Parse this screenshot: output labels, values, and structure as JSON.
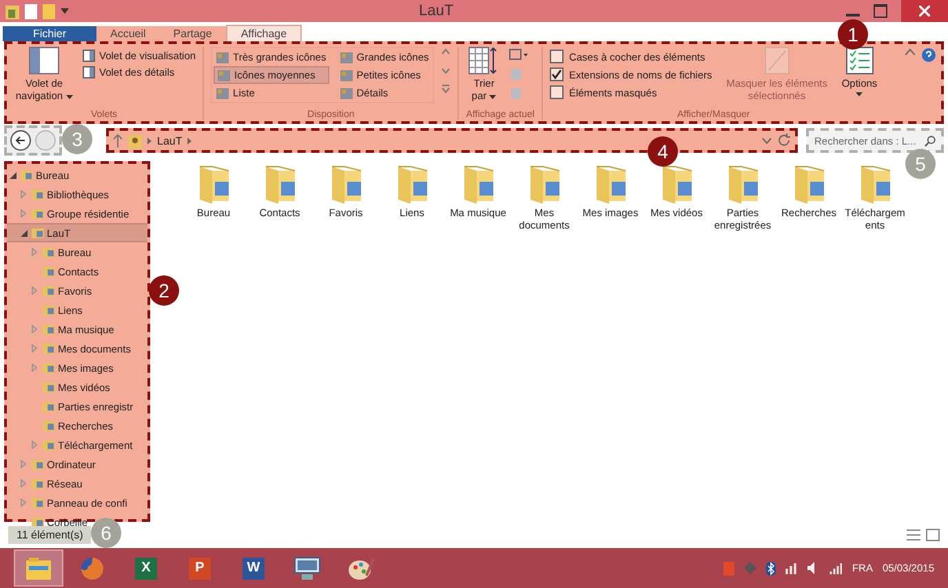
{
  "window": {
    "title": "LauT"
  },
  "ribbon_tabs": [
    {
      "label": "Fichier",
      "kind": "file",
      "selected": false
    },
    {
      "label": "Accueil",
      "kind": "tab",
      "selected": false
    },
    {
      "label": "Partage",
      "kind": "tab",
      "selected": false
    },
    {
      "label": "Affichage",
      "kind": "tab",
      "selected": true
    }
  ],
  "ribbon": {
    "panes": {
      "big_button": "Volet de navigation",
      "items": [
        "Volet de visualisation",
        "Volet des détails"
      ],
      "group_label": "Volets"
    },
    "layout": {
      "options": [
        {
          "label": "Très grandes icônes",
          "selected": false
        },
        {
          "label": "Grandes icônes",
          "selected": false
        },
        {
          "label": "Icônes moyennes",
          "selected": true
        },
        {
          "label": "Petites icônes",
          "selected": false
        },
        {
          "label": "Liste",
          "selected": false
        },
        {
          "label": "Détails",
          "selected": false
        }
      ],
      "group_label": "Disposition"
    },
    "current_view": {
      "sort_button": "Trier par",
      "group_label": "Affichage actuel"
    },
    "show_hide": {
      "checkboxes": [
        {
          "label": "Cases à cocher des éléments",
          "checked": false
        },
        {
          "label": "Extensions de noms de fichiers",
          "checked": true
        },
        {
          "label": "Éléments masqués",
          "checked": false
        }
      ],
      "hide_button": {
        "label": "Masquer les éléments sélectionnés",
        "disabled": true
      },
      "options_button": "Options",
      "group_label": "Afficher/Masquer"
    }
  },
  "address_bar": {
    "path": [
      "LauT"
    ]
  },
  "search": {
    "placeholder": "Rechercher dans : L..."
  },
  "nav_tree": [
    {
      "label": "Bureau",
      "expandable": true,
      "expanded": true,
      "selected": false,
      "children": [
        {
          "label": "Bibliothèques",
          "expandable": true,
          "expanded": false,
          "selected": false
        },
        {
          "label": "Groupe résidentie",
          "expandable": true,
          "expanded": false,
          "selected": false
        },
        {
          "label": "LauT",
          "expandable": true,
          "expanded": true,
          "selected": true,
          "children": [
            {
              "label": "Bureau",
              "expandable": true,
              "expanded": false,
              "selected": false
            },
            {
              "label": "Contacts",
              "expandable": false,
              "selected": false
            },
            {
              "label": "Favoris",
              "expandable": true,
              "expanded": false,
              "selected": false
            },
            {
              "label": "Liens",
              "expandable": false,
              "selected": false
            },
            {
              "label": "Ma musique",
              "expandable": true,
              "expanded": false,
              "selected": false
            },
            {
              "label": "Mes documents",
              "expandable": true,
              "expanded": false,
              "selected": false
            },
            {
              "label": "Mes images",
              "expandable": true,
              "expanded": false,
              "selected": false
            },
            {
              "label": "Mes vidéos",
              "expandable": false,
              "selected": false
            },
            {
              "label": "Parties enregistr",
              "expandable": false,
              "selected": false
            },
            {
              "label": "Recherches",
              "expandable": false,
              "selected": false
            },
            {
              "label": "Téléchargement",
              "expandable": true,
              "expanded": false,
              "selected": false
            }
          ]
        },
        {
          "label": "Ordinateur",
          "expandable": true,
          "expanded": false,
          "selected": false
        },
        {
          "label": "Réseau",
          "expandable": true,
          "expanded": false,
          "selected": false
        },
        {
          "label": "Panneau de confi",
          "expandable": true,
          "expanded": false,
          "selected": false
        },
        {
          "label": "Corbeille",
          "expandable": false,
          "selected": false
        }
      ]
    }
  ],
  "files": [
    "Bureau",
    "Contacts",
    "Favoris",
    "Liens",
    "Ma musique",
    "Mes documents",
    "Mes images",
    "Mes vidéos",
    "Parties enregistrées",
    "Recherches",
    "Téléchargements"
  ],
  "status_bar": {
    "count": "11 élément(s)"
  },
  "taskbar": {
    "apps": [
      {
        "kind": "explorer",
        "selected": true
      },
      {
        "kind": "firefox",
        "selected": false
      },
      {
        "kind": "excel",
        "letter": "X",
        "selected": false
      },
      {
        "kind": "powerpoint",
        "letter": "P",
        "selected": false
      },
      {
        "kind": "word",
        "letter": "W",
        "selected": false
      },
      {
        "kind": "network",
        "selected": false
      },
      {
        "kind": "paint",
        "selected": false
      }
    ],
    "language": "FRA",
    "date": "05/03/2015"
  },
  "callouts": [
    {
      "number": "1",
      "color": "#8b1111"
    },
    {
      "number": "2",
      "color": "#8b1111"
    },
    {
      "number": "3",
      "color": "#a3a39a"
    },
    {
      "number": "4",
      "color": "#8b1111"
    },
    {
      "number": "5",
      "color": "#a3a39a"
    },
    {
      "number": "6",
      "color": "#a3a39a"
    }
  ]
}
